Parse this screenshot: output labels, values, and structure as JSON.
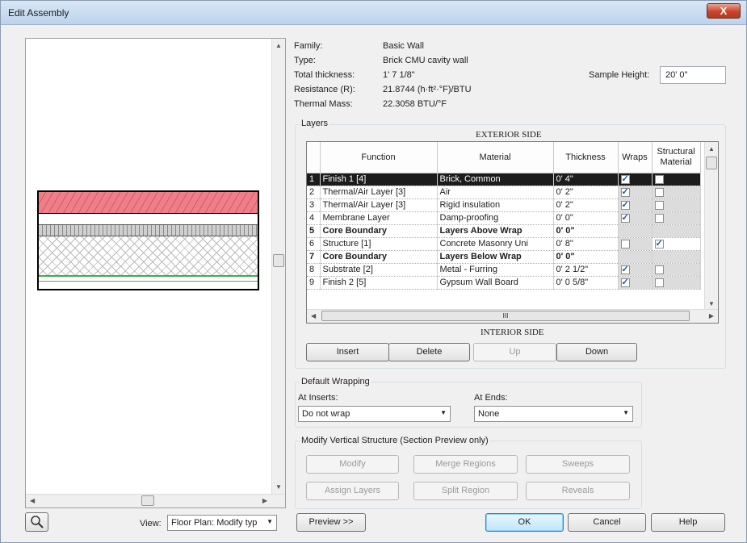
{
  "window": {
    "title": "Edit Assembly",
    "close_label": "X"
  },
  "properties": {
    "family_label": "Family:",
    "family_value": "Basic Wall",
    "type_label": "Type:",
    "type_value": "Brick CMU cavity wall",
    "thickness_label": "Total thickness:",
    "thickness_value": "1'  7 1/8\"",
    "resistance_label": "Resistance (R):",
    "resistance_value": "21.8744 (h·ft²·°F)/BTU",
    "mass_label": "Thermal Mass:",
    "mass_value": "22.3058 BTU/°F",
    "sample_height_label": "Sample Height:",
    "sample_height_value": "20'  0\""
  },
  "layers": {
    "group_label": "Layers",
    "exterior_label": "EXTERIOR SIDE",
    "interior_label": "INTERIOR SIDE",
    "columns": {
      "function": "Function",
      "material": "Material",
      "thickness": "Thickness",
      "wraps": "Wraps",
      "structural": "Structural Material"
    },
    "rows": [
      {
        "num": "1",
        "function": "Finish 1 [4]",
        "material": "Brick, Common",
        "thickness": "0'  4\"",
        "wraps": true,
        "structural": false,
        "selected": true
      },
      {
        "num": "2",
        "function": "Thermal/Air Layer [3]",
        "material": "Air",
        "thickness": "0'  2\"",
        "wraps": true,
        "structural": false
      },
      {
        "num": "3",
        "function": "Thermal/Air Layer [3]",
        "material": "Rigid insulation",
        "thickness": "0'  2\"",
        "wraps": true,
        "structural": false
      },
      {
        "num": "4",
        "function": "Membrane Layer",
        "material": "Damp-proofing",
        "thickness": "0'  0\"",
        "wraps": true,
        "structural": false
      },
      {
        "num": "5",
        "function": "Core Boundary",
        "material": "Layers Above Wrap",
        "thickness": "0'  0\"",
        "bold": true
      },
      {
        "num": "6",
        "function": "Structure [1]",
        "material": "Concrete Masonry Uni",
        "thickness": "0'  8\"",
        "wraps": false,
        "structural": true
      },
      {
        "num": "7",
        "function": "Core Boundary",
        "material": "Layers Below Wrap",
        "thickness": "0'  0\"",
        "bold": true
      },
      {
        "num": "8",
        "function": "Substrate [2]",
        "material": "Metal - Furring",
        "thickness": "0'  2 1/2\"",
        "wraps": true,
        "structural": false
      },
      {
        "num": "9",
        "function": "Finish 2 [5]",
        "material": "Gypsum Wall Board",
        "thickness": "0'  0 5/8\"",
        "wraps": true,
        "structural": false
      }
    ],
    "hscroll_label": "III",
    "buttons": {
      "insert": "Insert",
      "delete": "Delete",
      "up": "Up",
      "down": "Down"
    }
  },
  "wrapping": {
    "group_label": "Default Wrapping",
    "inserts_label": "At Inserts:",
    "inserts_value": "Do not wrap",
    "ends_label": "At Ends:",
    "ends_value": "None"
  },
  "vertical": {
    "group_label": "Modify Vertical Structure (Section Preview only)",
    "modify": "Modify",
    "merge": "Merge Regions",
    "sweeps": "Sweeps",
    "assign": "Assign Layers",
    "split": "Split Region",
    "reveals": "Reveals"
  },
  "footer": {
    "view_label": "View:",
    "view_value": "Floor Plan: Modify typ",
    "preview": "Preview >>",
    "ok": "OK",
    "cancel": "Cancel",
    "help": "Help"
  }
}
